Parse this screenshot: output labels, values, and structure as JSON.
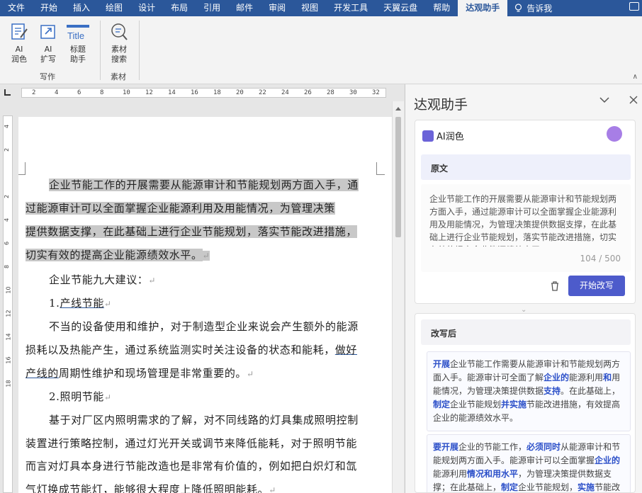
{
  "tabs": [
    "文件",
    "开始",
    "插入",
    "绘图",
    "设计",
    "布局",
    "引用",
    "邮件",
    "审阅",
    "视图",
    "开发工具",
    "天翼云盘",
    "帮助",
    "达观助手"
  ],
  "tell_me": "告诉我",
  "ribbon": {
    "buttons": [
      {
        "label": "AI\n润色",
        "icon": "ai-polish-icon"
      },
      {
        "label": "AI\n扩写",
        "icon": "ai-expand-icon"
      },
      {
        "label": "标题\n助手",
        "icon": "title-icon"
      },
      {
        "label": "素材\n搜索",
        "icon": "search-icon"
      }
    ],
    "group_write": "写作",
    "group_material": "素材",
    "title_icon_text": "Title"
  },
  "ruler": {
    "h_ticks": [
      "2",
      "4",
      "6",
      "8",
      "10",
      "12",
      "14",
      "16",
      "18",
      "20",
      "22",
      "24",
      "26",
      "28",
      "30",
      "32"
    ],
    "v_ticks": [
      "4",
      "2",
      "",
      "2",
      "4",
      "6",
      "8",
      "10",
      "12",
      "14",
      "16",
      "18"
    ]
  },
  "document": {
    "para1_lines": [
      "企业节能工作的开展需要从能源审计和节能规划两方面入手，通",
      "过能源审计可以全面掌握企业能源利用及用能情况，为管理决策",
      "提供数据支撑，在此基础上进行企业节能规划，落实节能改进措施，",
      "切实有效的提高企业能源绩效水平。"
    ],
    "suggest_title": "企业节能九大建议：",
    "item1": "1.",
    "item1_text": "产线节能",
    "para2_lines": [
      "不当的设备使用和维护，对于制造型企业来说会产生额外的能源",
      "损耗以及热能产生，通过系统监测实时关注设备的状态和能耗，"
    ],
    "para2_link1": "做好",
    "para2_link2": "产线的",
    "para2_tail": "周期性维护和现场管理是非常重要的。",
    "item2": "2.照明节能",
    "para3_lines": [
      "基于对厂区内照明需求的了解，对不同线路的灯具集成照明控制",
      "装置进行策略控制，通过灯光开关或调节来降低能耗，对于照明节能",
      "而言对灯具本身进行节能改造也是非常有价值的，例如把白炽灯和氙",
      "气灯换成节能灯，能够很大程度上降低照明能耗。"
    ],
    "para_mark": "↵"
  },
  "panel": {
    "title": "达观助手",
    "ai_tag": "AI润色",
    "orig_label": "原文",
    "orig_text": "企业节能工作的开展需要从能源审计和节能规划两方面入手，通过能源审计可以全面掌握企业能源利用及用能情况，为管理决策提供数据支撑，在此基础上进行企业节能规划，落实节能改进措施，切实有效的提高企业能源绩效水平。",
    "count": "104 / 500",
    "start_button": "开始改写",
    "rewrite_label": "改写后",
    "rewrite1": [
      {
        "t": "开展",
        "b": true
      },
      {
        "t": "企业节能工作需要从能源审计和节能规划两方面入手。",
        "b": false
      },
      {
        "t": "能源审计可全面了解",
        "b": false
      },
      {
        "t": "企业的",
        "b": true
      },
      {
        "t": "能源利用",
        "b": false
      },
      {
        "t": "和",
        "b": true
      },
      {
        "t": "用能情况，为管理决策提供数据",
        "b": false
      },
      {
        "t": "支持",
        "b": true
      },
      {
        "t": "。在此基础上，",
        "b": false
      },
      {
        "t": "制定",
        "b": true
      },
      {
        "t": "企业节能规划",
        "b": false
      },
      {
        "t": "并实施",
        "b": true
      },
      {
        "t": "节能改进措施，有效提高企业的能源绩效水平。",
        "b": false
      }
    ],
    "rewrite2": [
      {
        "t": "要开展",
        "b": true
      },
      {
        "t": "企业的",
        "b": false
      },
      {
        "t": "节能工作，",
        "b": false
      },
      {
        "t": "必须同时",
        "b": true
      },
      {
        "t": "从能源审计和节能规划两方面入手。能源审计可以全面掌握",
        "b": false
      },
      {
        "t": "企业的",
        "b": true
      },
      {
        "t": "能源利用",
        "b": false
      },
      {
        "t": "情况和用水平",
        "b": true
      },
      {
        "t": "，为管理决策提供数据支撑；在此基础上，",
        "b": false
      },
      {
        "t": "制定",
        "b": true
      },
      {
        "t": "企业节能规划，",
        "b": false
      },
      {
        "t": "实施",
        "b": true
      },
      {
        "t": "节能改进措施",
        "b": false
      }
    ]
  }
}
